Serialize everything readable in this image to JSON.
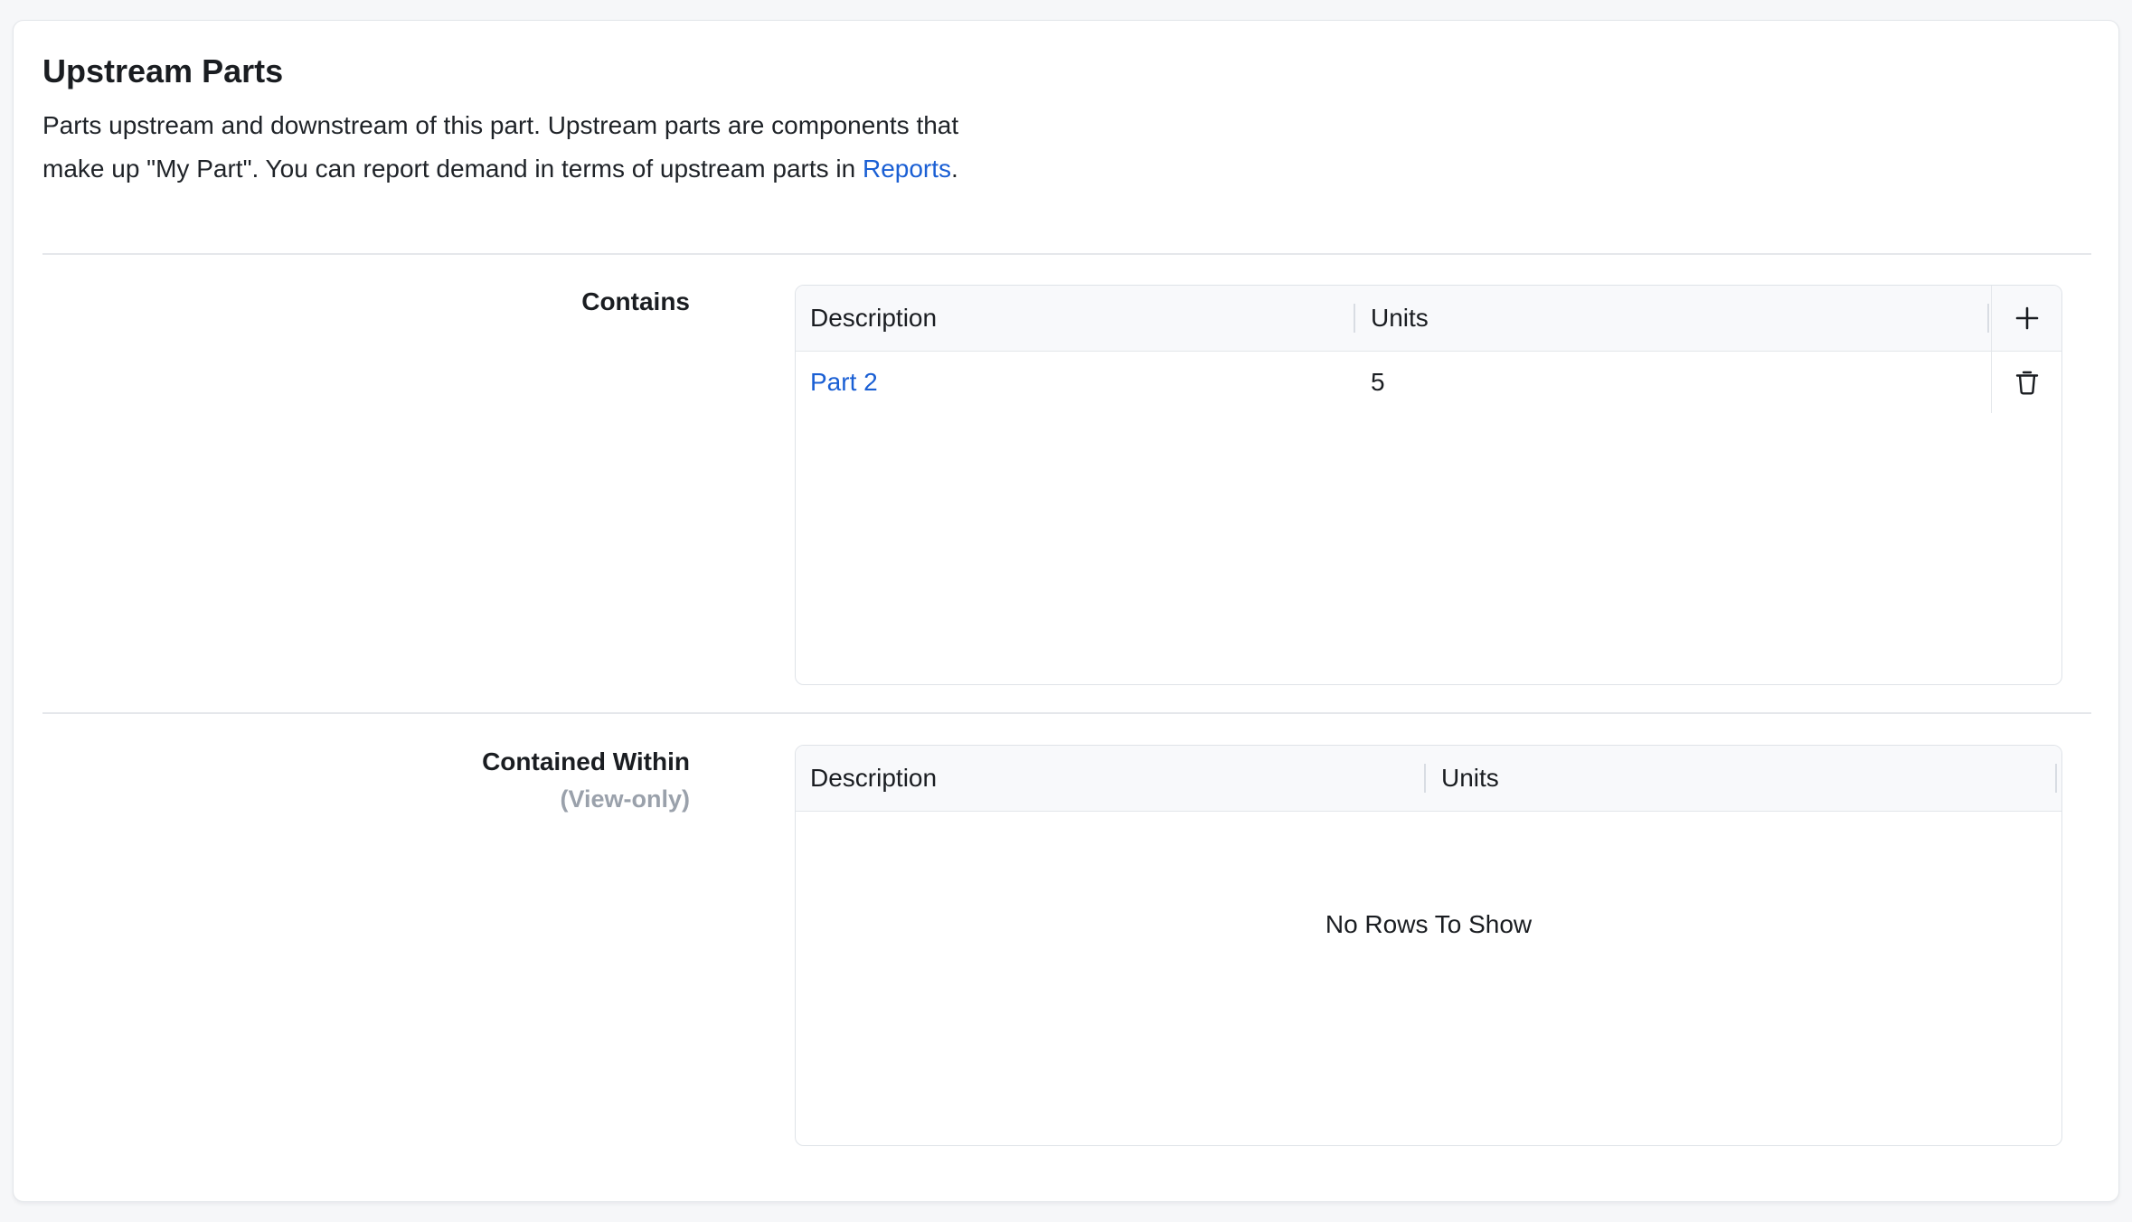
{
  "section": {
    "title": "Upstream Parts",
    "description_text": "Parts upstream and downstream of this part. Upstream parts are components that make up \"My Part\". You can report demand in terms of upstream parts in ",
    "description_link": "Reports",
    "description_end": "."
  },
  "contains": {
    "label": "Contains",
    "columns": [
      "Description",
      "Units"
    ],
    "rows": [
      {
        "description": "Part 2",
        "units": "5"
      }
    ],
    "add_icon": "plus-icon",
    "delete_icon": "trash-icon"
  },
  "contained_within": {
    "label": "Contained Within",
    "sublabel": "(View-only)",
    "columns": [
      "Description",
      "Units"
    ],
    "empty_message": "No Rows To Show"
  },
  "colors": {
    "link": "#1a5fd4",
    "muted": "#9aa1ab",
    "border": "#dfe3e8",
    "header_bg": "#f8f9fb"
  }
}
